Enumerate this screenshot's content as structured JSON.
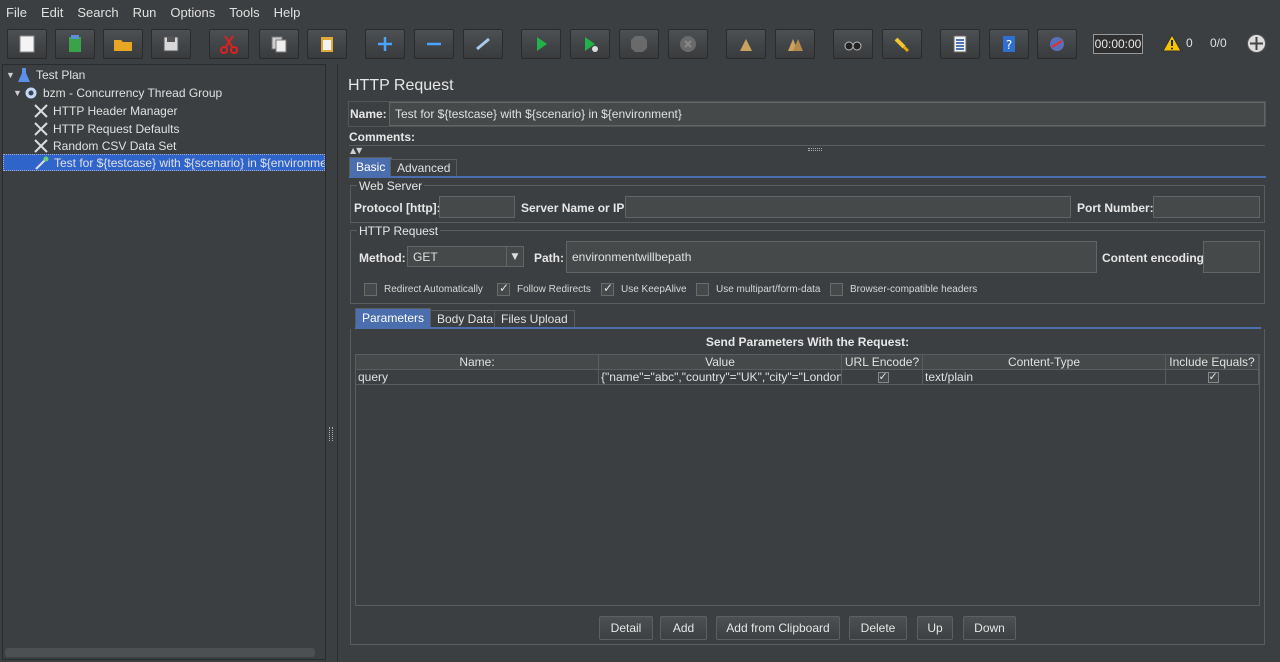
{
  "menu": [
    "File",
    "Edit",
    "Search",
    "Run",
    "Options",
    "Tools",
    "Help"
  ],
  "toolbar": {
    "timer": "00:00:00",
    "warning_count": "0",
    "thread_count": "0/0"
  },
  "tree": {
    "items": [
      {
        "label": "Test Plan",
        "icon": "flask-icon"
      },
      {
        "label": "bzm - Concurrency Thread Group",
        "icon": "gear-icon"
      },
      {
        "label": "HTTP Header Manager",
        "icon": "wrench-icon"
      },
      {
        "label": "HTTP Request Defaults",
        "icon": "wrench-icon"
      },
      {
        "label": "Random CSV Data Set",
        "icon": "wrench-icon"
      },
      {
        "label": "Test for ${testcase} with ${scenario} in ${environment}",
        "icon": "pipette-icon"
      }
    ]
  },
  "panel": {
    "title": "HTTP Request",
    "name_label": "Name:",
    "name_value": "Test for ${testcase} with ${scenario} in ${environment}",
    "comments_label": "Comments:",
    "tabs": [
      "Basic",
      "Advanced"
    ],
    "web_server": {
      "title": "Web Server",
      "protocol_label": "Protocol [http]:",
      "protocol_value": "",
      "server_label": "Server Name or IP:",
      "server_value": "",
      "port_label": "Port Number:",
      "port_value": ""
    },
    "http_request": {
      "title": "HTTP Request",
      "method_label": "Method:",
      "method_value": "GET",
      "path_label": "Path:",
      "path_value": "environmentwillbepath",
      "encoding_label": "Content encoding:",
      "encoding_value": ""
    },
    "options": [
      {
        "label": "Redirect Automatically",
        "checked": false
      },
      {
        "label": "Follow Redirects",
        "checked": true
      },
      {
        "label": "Use KeepAlive",
        "checked": true
      },
      {
        "label": "Use multipart/form-data",
        "checked": false
      },
      {
        "label": "Browser-compatible headers",
        "checked": false
      }
    ],
    "param_tabs": [
      "Parameters",
      "Body Data",
      "Files Upload"
    ],
    "params_heading": "Send Parameters With the Request:",
    "columns": [
      "Name:",
      "Value",
      "URL Encode?",
      "Content-Type",
      "Include Equals?"
    ],
    "rows": [
      {
        "name": "query",
        "value": "{\"name\"=\"abc\",\"country\"=\"UK\",\"city\"=\"London\"}",
        "url_encode": true,
        "content_type": "text/plain",
        "include_equals": true
      }
    ],
    "buttons": [
      "Detail",
      "Add",
      "Add from Clipboard",
      "Delete",
      "Up",
      "Down"
    ]
  }
}
